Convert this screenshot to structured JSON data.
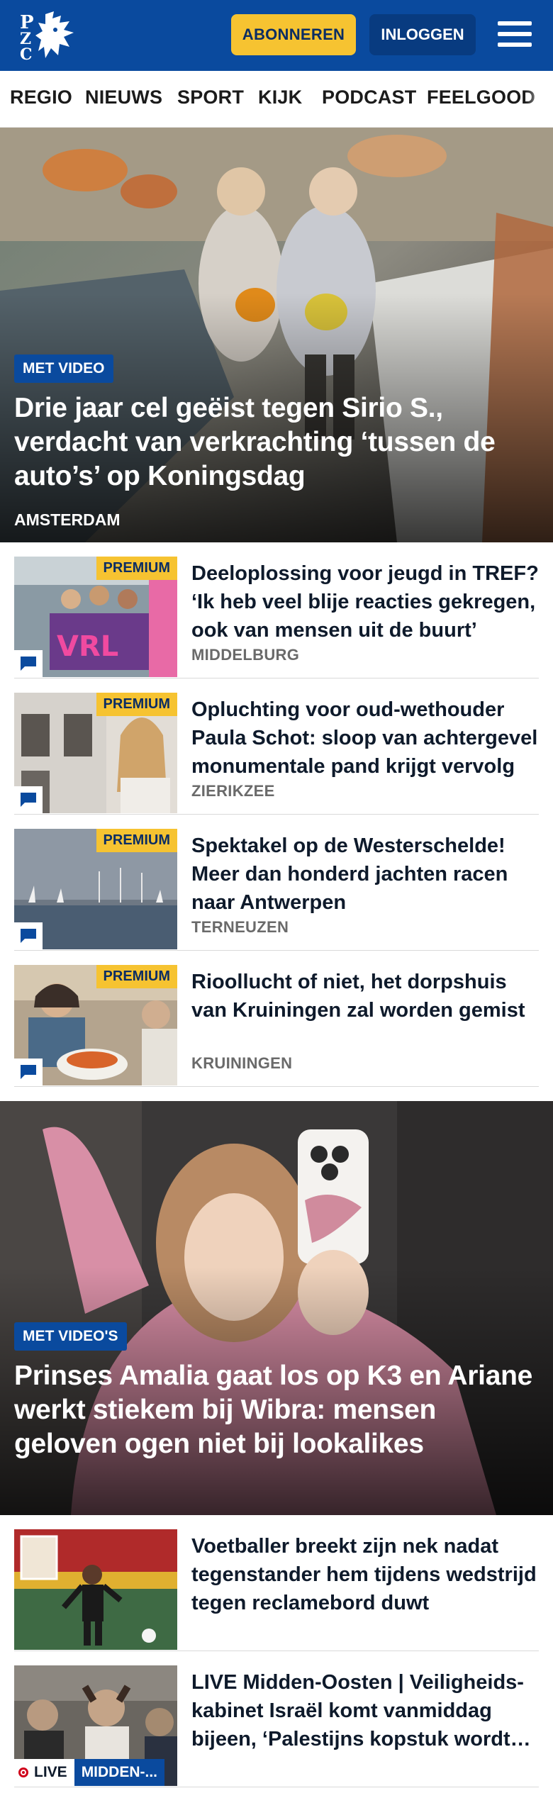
{
  "header": {
    "logo_text": "PZC",
    "subscribe_label": "ABONNEREN",
    "login_label": "INLOGGEN",
    "brand_color": "#0a4a9e",
    "accent_color": "#f6c331"
  },
  "nav": {
    "items": [
      "REGIO",
      "NIEUWS",
      "SPORT",
      "KIJK",
      "PODCAST",
      "FEELGOOD"
    ]
  },
  "hero1": {
    "badge": "MET VIDEO",
    "title": "Drie jaar cel geëist tegen Sirio S., verdacht van verkrachting ‘tussen de auto’s’ op Koningsdag",
    "location": "AMSTERDAM"
  },
  "articles": [
    {
      "badge": "PREMIUM",
      "title": "Deeloplossing voor jeugd in TREF? ‘Ik heb veel blije reacties gekregen, ook van mensen uit de buurt’",
      "location": "MIDDELBURG"
    },
    {
      "badge": "PREMIUM",
      "title": "Opluchting voor oud-wethouder Paula Schot: sloop van achterge­vel monumentale pand krijgt vervolg",
      "location": "ZIERIKZEE"
    },
    {
      "badge": "PREMIUM",
      "title": "Spektakel op de Westerschelde! Meer dan honderd jachten racen naar Antwerpen",
      "location": "TERNEUZEN"
    },
    {
      "badge": "PREMIUM",
      "title": "Rioollucht of niet, het dorpshuis van Kruiningen zal worden gemist",
      "location": "KRUININGEN"
    }
  ],
  "hero2": {
    "badge": "MET VIDEO'S",
    "title": "Prinses Amalia gaat los op K3 en Ariane werkt stiekem bij Wibra: mensen geloven ogen niet bij lookalikes"
  },
  "articles2": [
    {
      "title": "Voetballer breekt zijn nek nadat tegenstander hem tijdens wedstrijd tegen reclamebord duwt"
    },
    {
      "title": "LIVE Midden-Oosten | Veiligheids­kabinet Israël komt vanmiddag bijeen, ‘Palestijns kopstuk wordt vrijgelaten’",
      "live_label": "LIVE",
      "tag_label": "MIDDEN-..."
    }
  ]
}
